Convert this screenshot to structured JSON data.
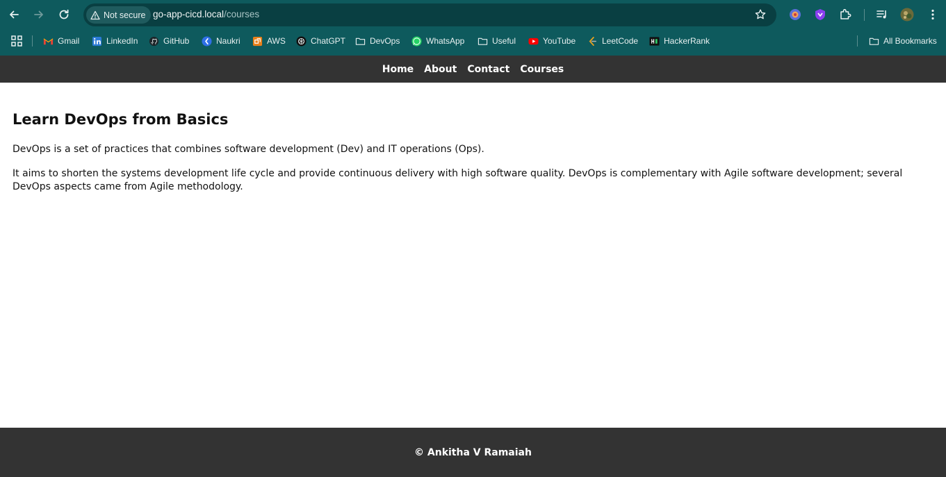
{
  "browser": {
    "back_icon": "arrow-left-icon",
    "forward_icon": "arrow-right-icon",
    "reload_icon": "reload-icon",
    "security_label": "Not secure",
    "url_host": "go-app-cicd.local",
    "url_path": "/courses",
    "bookmarks": [
      {
        "label": "Gmail",
        "icon": "gmail-icon"
      },
      {
        "label": "LinkedIn",
        "icon": "linkedin-icon"
      },
      {
        "label": "GitHub",
        "icon": "github-icon"
      },
      {
        "label": "Naukri",
        "icon": "naukri-icon"
      },
      {
        "label": "AWS",
        "icon": "aws-icon"
      },
      {
        "label": "ChatGPT",
        "icon": "chatgpt-icon"
      },
      {
        "label": "DevOps",
        "icon": "folder-icon"
      },
      {
        "label": "WhatsApp",
        "icon": "whatsapp-icon"
      },
      {
        "label": "Useful",
        "icon": "folder-icon"
      },
      {
        "label": "YouTube",
        "icon": "youtube-icon"
      },
      {
        "label": "LeetCode",
        "icon": "leetcode-icon"
      },
      {
        "label": "HackerRank",
        "icon": "hackerrank-icon"
      }
    ],
    "all_bookmarks_label": "All Bookmarks"
  },
  "site": {
    "nav": [
      "Home",
      "About",
      "Contact",
      "Courses"
    ],
    "heading": "Learn DevOps from Basics",
    "paragraph_1": "DevOps is a set of practices that combines software development (Dev) and IT operations (Ops).",
    "paragraph_2": "It aims to shorten the systems development life cycle and provide continuous delivery with high software quality. DevOps is complementary with Agile software development; several DevOps aspects came from Agile methodology.",
    "footer": "© Ankitha V Ramaiah"
  },
  "colors": {
    "chrome_bg": "#0e5a5d",
    "omnibox_bg": "#093f42",
    "site_nav_bg": "#333333",
    "footer_bg": "#333333",
    "page_bg": "#ffffff"
  }
}
